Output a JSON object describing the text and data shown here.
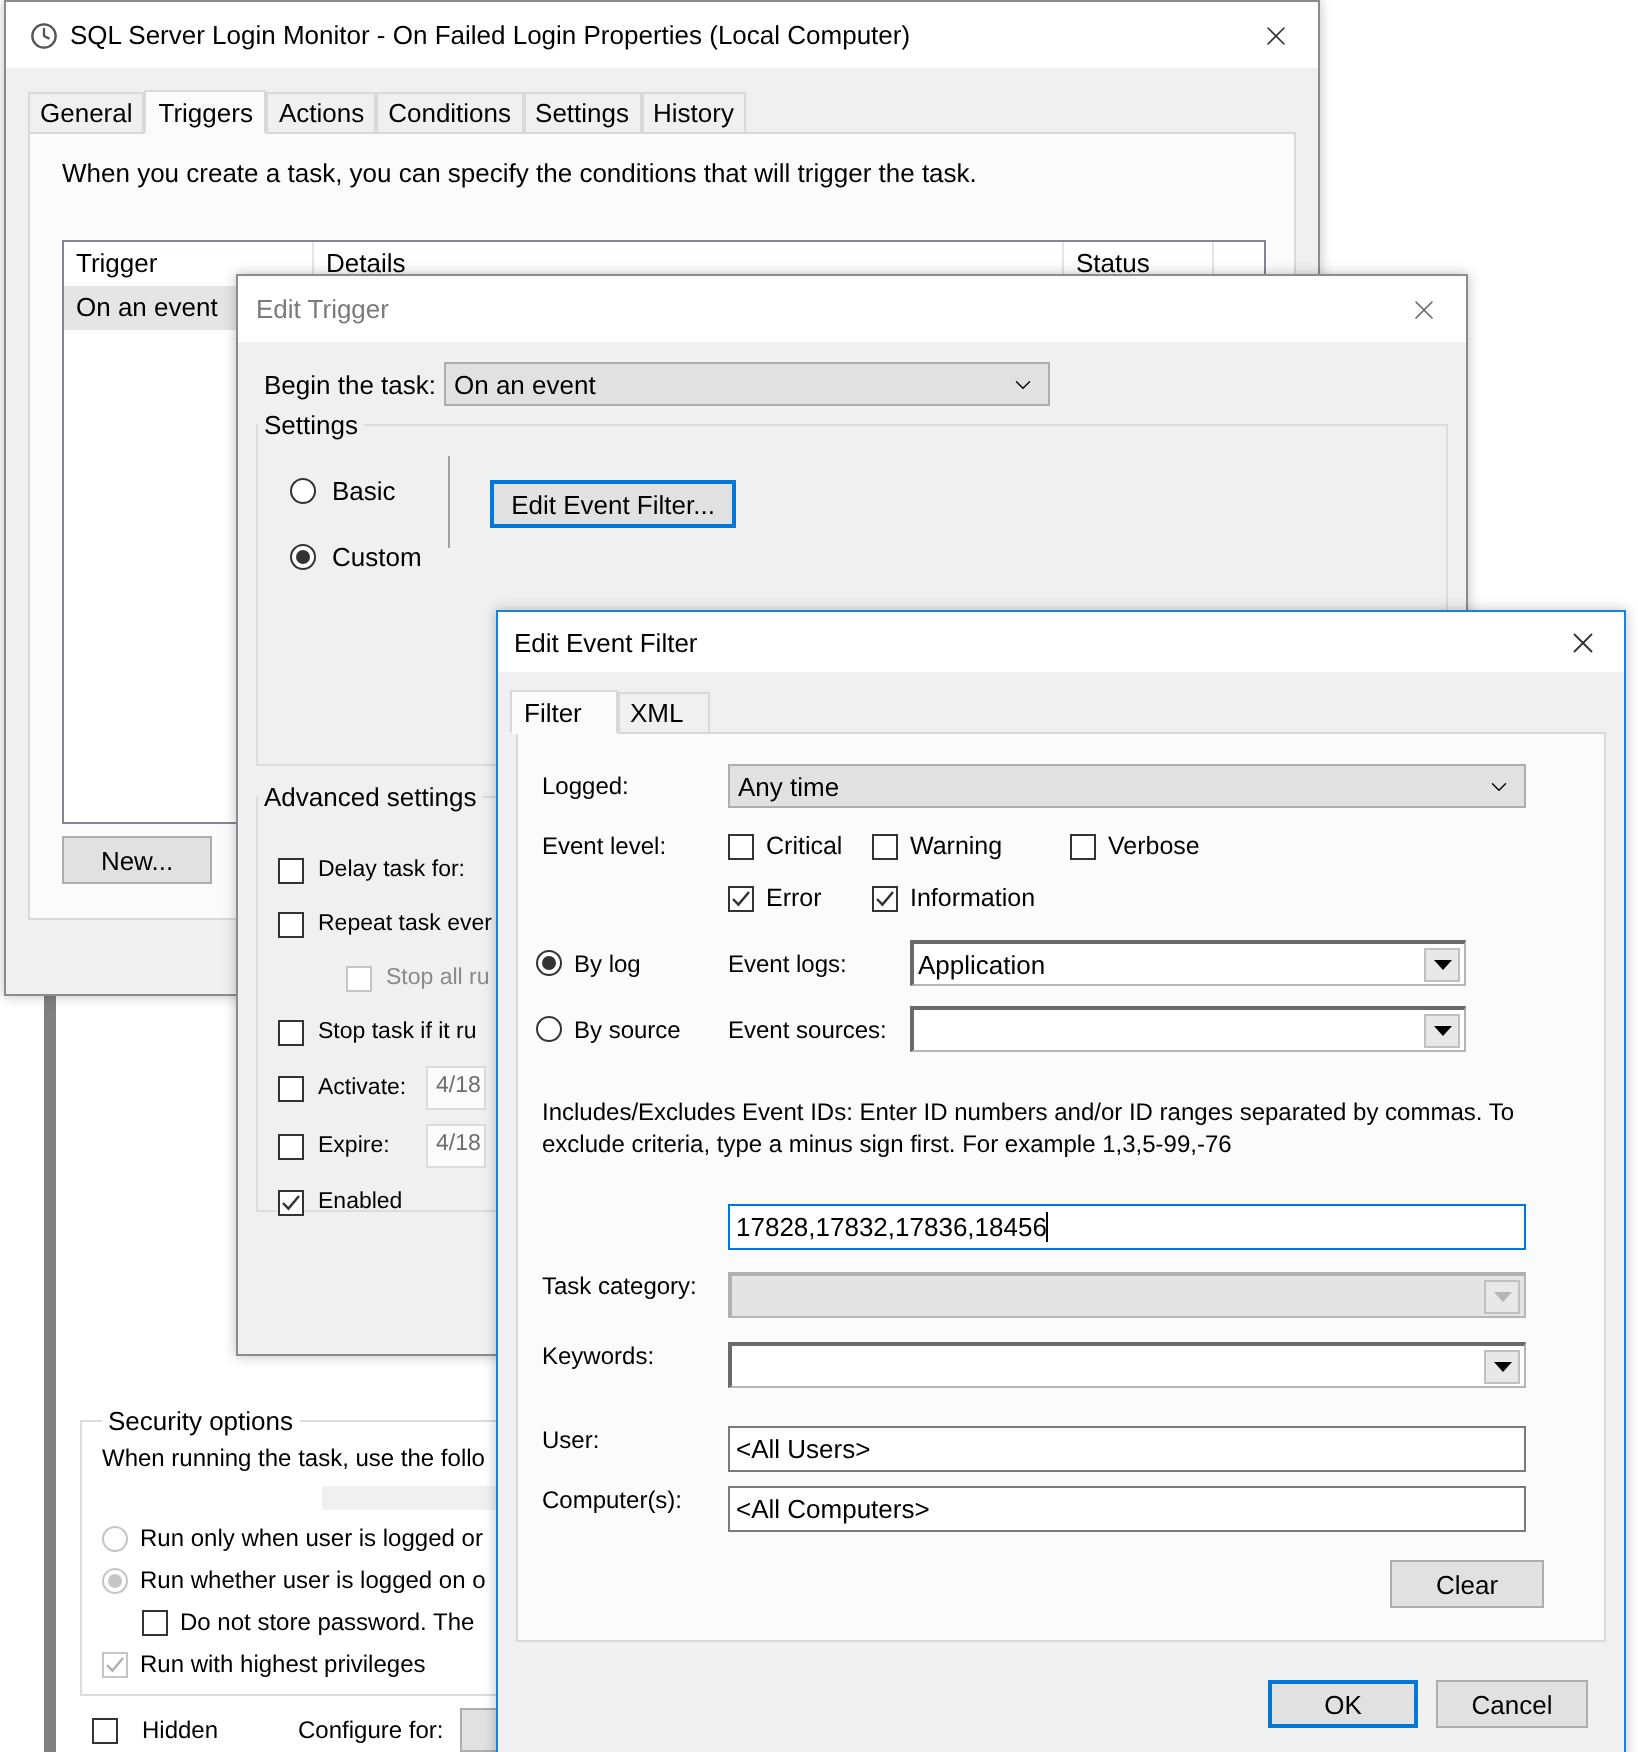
{
  "properties_window": {
    "title": "SQL Server Login Monitor - On Failed Login Properties (Local Computer)",
    "tabs": [
      {
        "label": "General",
        "selected": false
      },
      {
        "label": "Triggers",
        "selected": true
      },
      {
        "label": "Actions",
        "selected": false
      },
      {
        "label": "Conditions",
        "selected": false
      },
      {
        "label": "Settings",
        "selected": false
      },
      {
        "label": "History",
        "selected": false
      }
    ],
    "description": "When you create a task, you can specify the conditions that will trigger the task.",
    "table": {
      "columns": [
        "Trigger",
        "Details",
        "Status"
      ],
      "rows": [
        {
          "trigger": "On an event",
          "selected": true
        }
      ]
    },
    "new_button": "New..."
  },
  "background_window": {
    "group_label": "Security options",
    "description": "When running the task, use the follo",
    "run_options": [
      {
        "label": "Run only when user is logged or",
        "selected": false
      },
      {
        "label": "Run whether user is logged on o",
        "selected": true
      }
    ],
    "password_check": {
      "label": "Do not store password.  The",
      "checked": false
    },
    "privileges_check": {
      "label": "Run with highest privileges",
      "checked": true
    },
    "hidden_check": {
      "label": "Hidden",
      "checked": false
    },
    "configure_label": "Configure for:"
  },
  "edit_trigger": {
    "title": "Edit Trigger",
    "begin_label": "Begin the task:",
    "begin_value": "On an event",
    "settings_label": "Settings",
    "modes": [
      {
        "label": "Basic",
        "selected": false
      },
      {
        "label": "Custom",
        "selected": true
      }
    ],
    "filter_button": "Edit Event Filter...",
    "advanced_label": "Advanced settings",
    "advanced": [
      {
        "kind": "check",
        "label": "Delay task for:",
        "checked": false,
        "disabled": false
      },
      {
        "kind": "check",
        "label": "Repeat task ever",
        "checked": false,
        "disabled": false,
        "children": [
          {
            "kind": "check",
            "label": "Stop all ru",
            "checked": false,
            "disabled": true
          }
        ]
      },
      {
        "kind": "check",
        "label": "Stop task if it ru",
        "checked": false,
        "disabled": false
      },
      {
        "kind": "date",
        "label": "Activate:",
        "checked": false,
        "disabled": false,
        "value": "4/18"
      },
      {
        "kind": "date",
        "label": "Expire:",
        "checked": false,
        "disabled": false,
        "value": "4/18"
      },
      {
        "kind": "check",
        "label": "Enabled",
        "checked": true,
        "disabled": false
      }
    ]
  },
  "edit_event_filter": {
    "title": "Edit Event Filter",
    "tabs": [
      {
        "label": "Filter",
        "selected": true
      },
      {
        "label": "XML",
        "selected": false
      }
    ],
    "logged_label": "Logged:",
    "logged_value": "Any time",
    "level_label": "Event level:",
    "levels": [
      {
        "label": "Critical",
        "checked": false
      },
      {
        "label": "Warning",
        "checked": false
      },
      {
        "label": "Verbose",
        "checked": false
      },
      {
        "label": "Error",
        "checked": true
      },
      {
        "label": "Information",
        "checked": true
      }
    ],
    "sources": [
      {
        "label": "By log",
        "selected": true,
        "field_label": "Event logs:",
        "value": "Application"
      },
      {
        "label": "By source",
        "selected": false,
        "field_label": "Event sources:"
      }
    ],
    "ids_help": "Includes/Excludes Event IDs: Enter ID numbers and/or ID ranges separated by commas. To exclude criteria, type a minus sign first. For example 1,3,5-99,-76",
    "ids_value": "17828,17832,17836,18456",
    "fields": [
      {
        "kind": "combo",
        "label": "Task category:",
        "disabled": true
      },
      {
        "kind": "combo",
        "label": "Keywords:",
        "disabled": false
      },
      {
        "kind": "text",
        "label": "User:",
        "value": "<All Users>",
        "disabled": false
      },
      {
        "kind": "text",
        "label": "Computer(s):",
        "value": "<All Computers>",
        "disabled": false
      }
    ],
    "clear_button": "Clear",
    "ok_button": "OK",
    "cancel_button": "Cancel"
  }
}
